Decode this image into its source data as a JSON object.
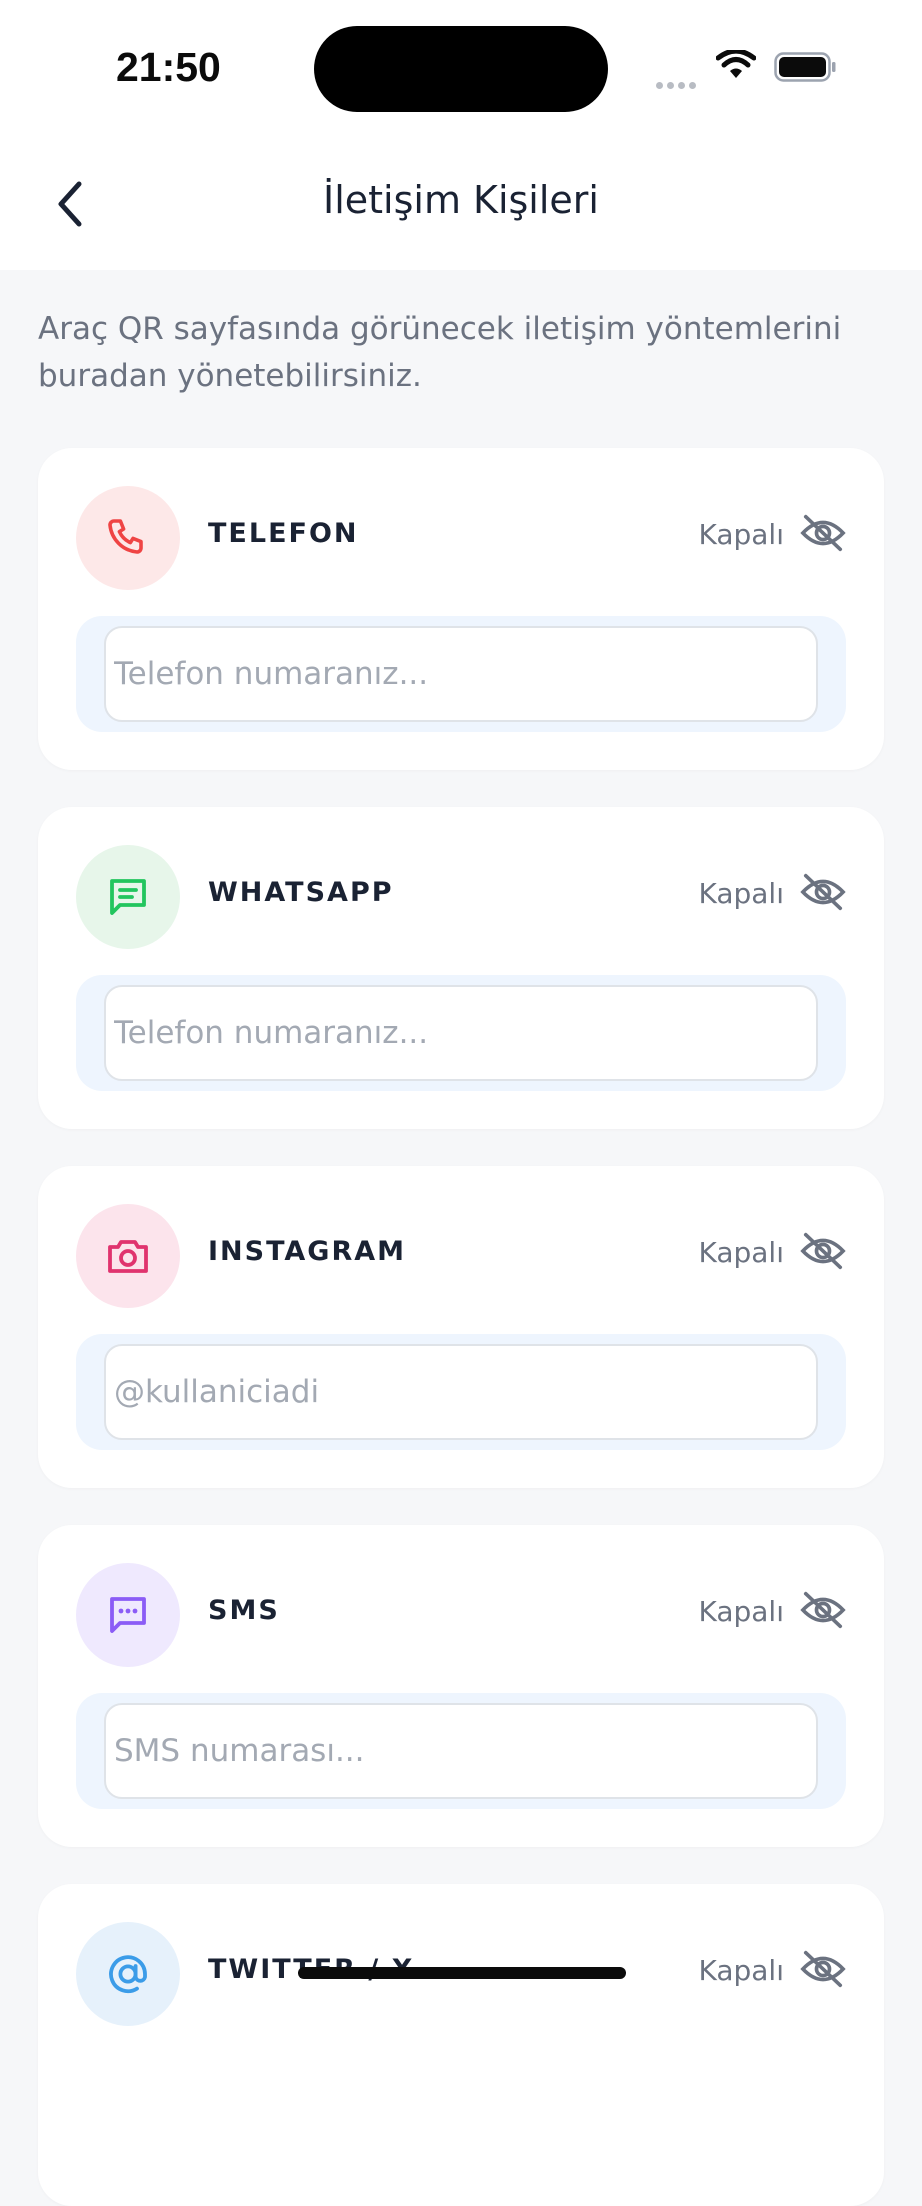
{
  "status_bar": {
    "time": "21:50"
  },
  "header": {
    "title": "İletişim Kişileri"
  },
  "intro": "Araç QR sayfasında görünecek iletişim yöntemlerini buradan yönetebilirsiniz.",
  "contacts": [
    {
      "title": "TELEFON",
      "status": "Kapalı",
      "placeholder": "Telefon numaranız...",
      "icon": "phone-icon",
      "icon_color": "#ef4444",
      "icon_bg": "#fde8e8"
    },
    {
      "title": "WHATSAPP",
      "status": "Kapalı",
      "placeholder": "Telefon numaranız...",
      "icon": "message-icon",
      "icon_color": "#22c55e",
      "icon_bg": "#e7f6ea"
    },
    {
      "title": "INSTAGRAM",
      "status": "Kapalı",
      "placeholder": "@kullaniciadi",
      "icon": "camera-icon",
      "icon_color": "#e0336e",
      "icon_bg": "#fce4ec"
    },
    {
      "title": "SMS",
      "status": "Kapalı",
      "placeholder": "SMS numarası...",
      "icon": "chat-dots-icon",
      "icon_color": "#8b5cf6",
      "icon_bg": "#efe9fe"
    },
    {
      "title": "TWITTER / X",
      "status": "Kapalı",
      "placeholder": "",
      "icon": "at-icon",
      "icon_color": "#3b9ce8",
      "icon_bg": "#e6f1fb"
    }
  ],
  "colors": {
    "accent_blue_bg": "#eef5fe",
    "muted_text": "#6b7280"
  }
}
